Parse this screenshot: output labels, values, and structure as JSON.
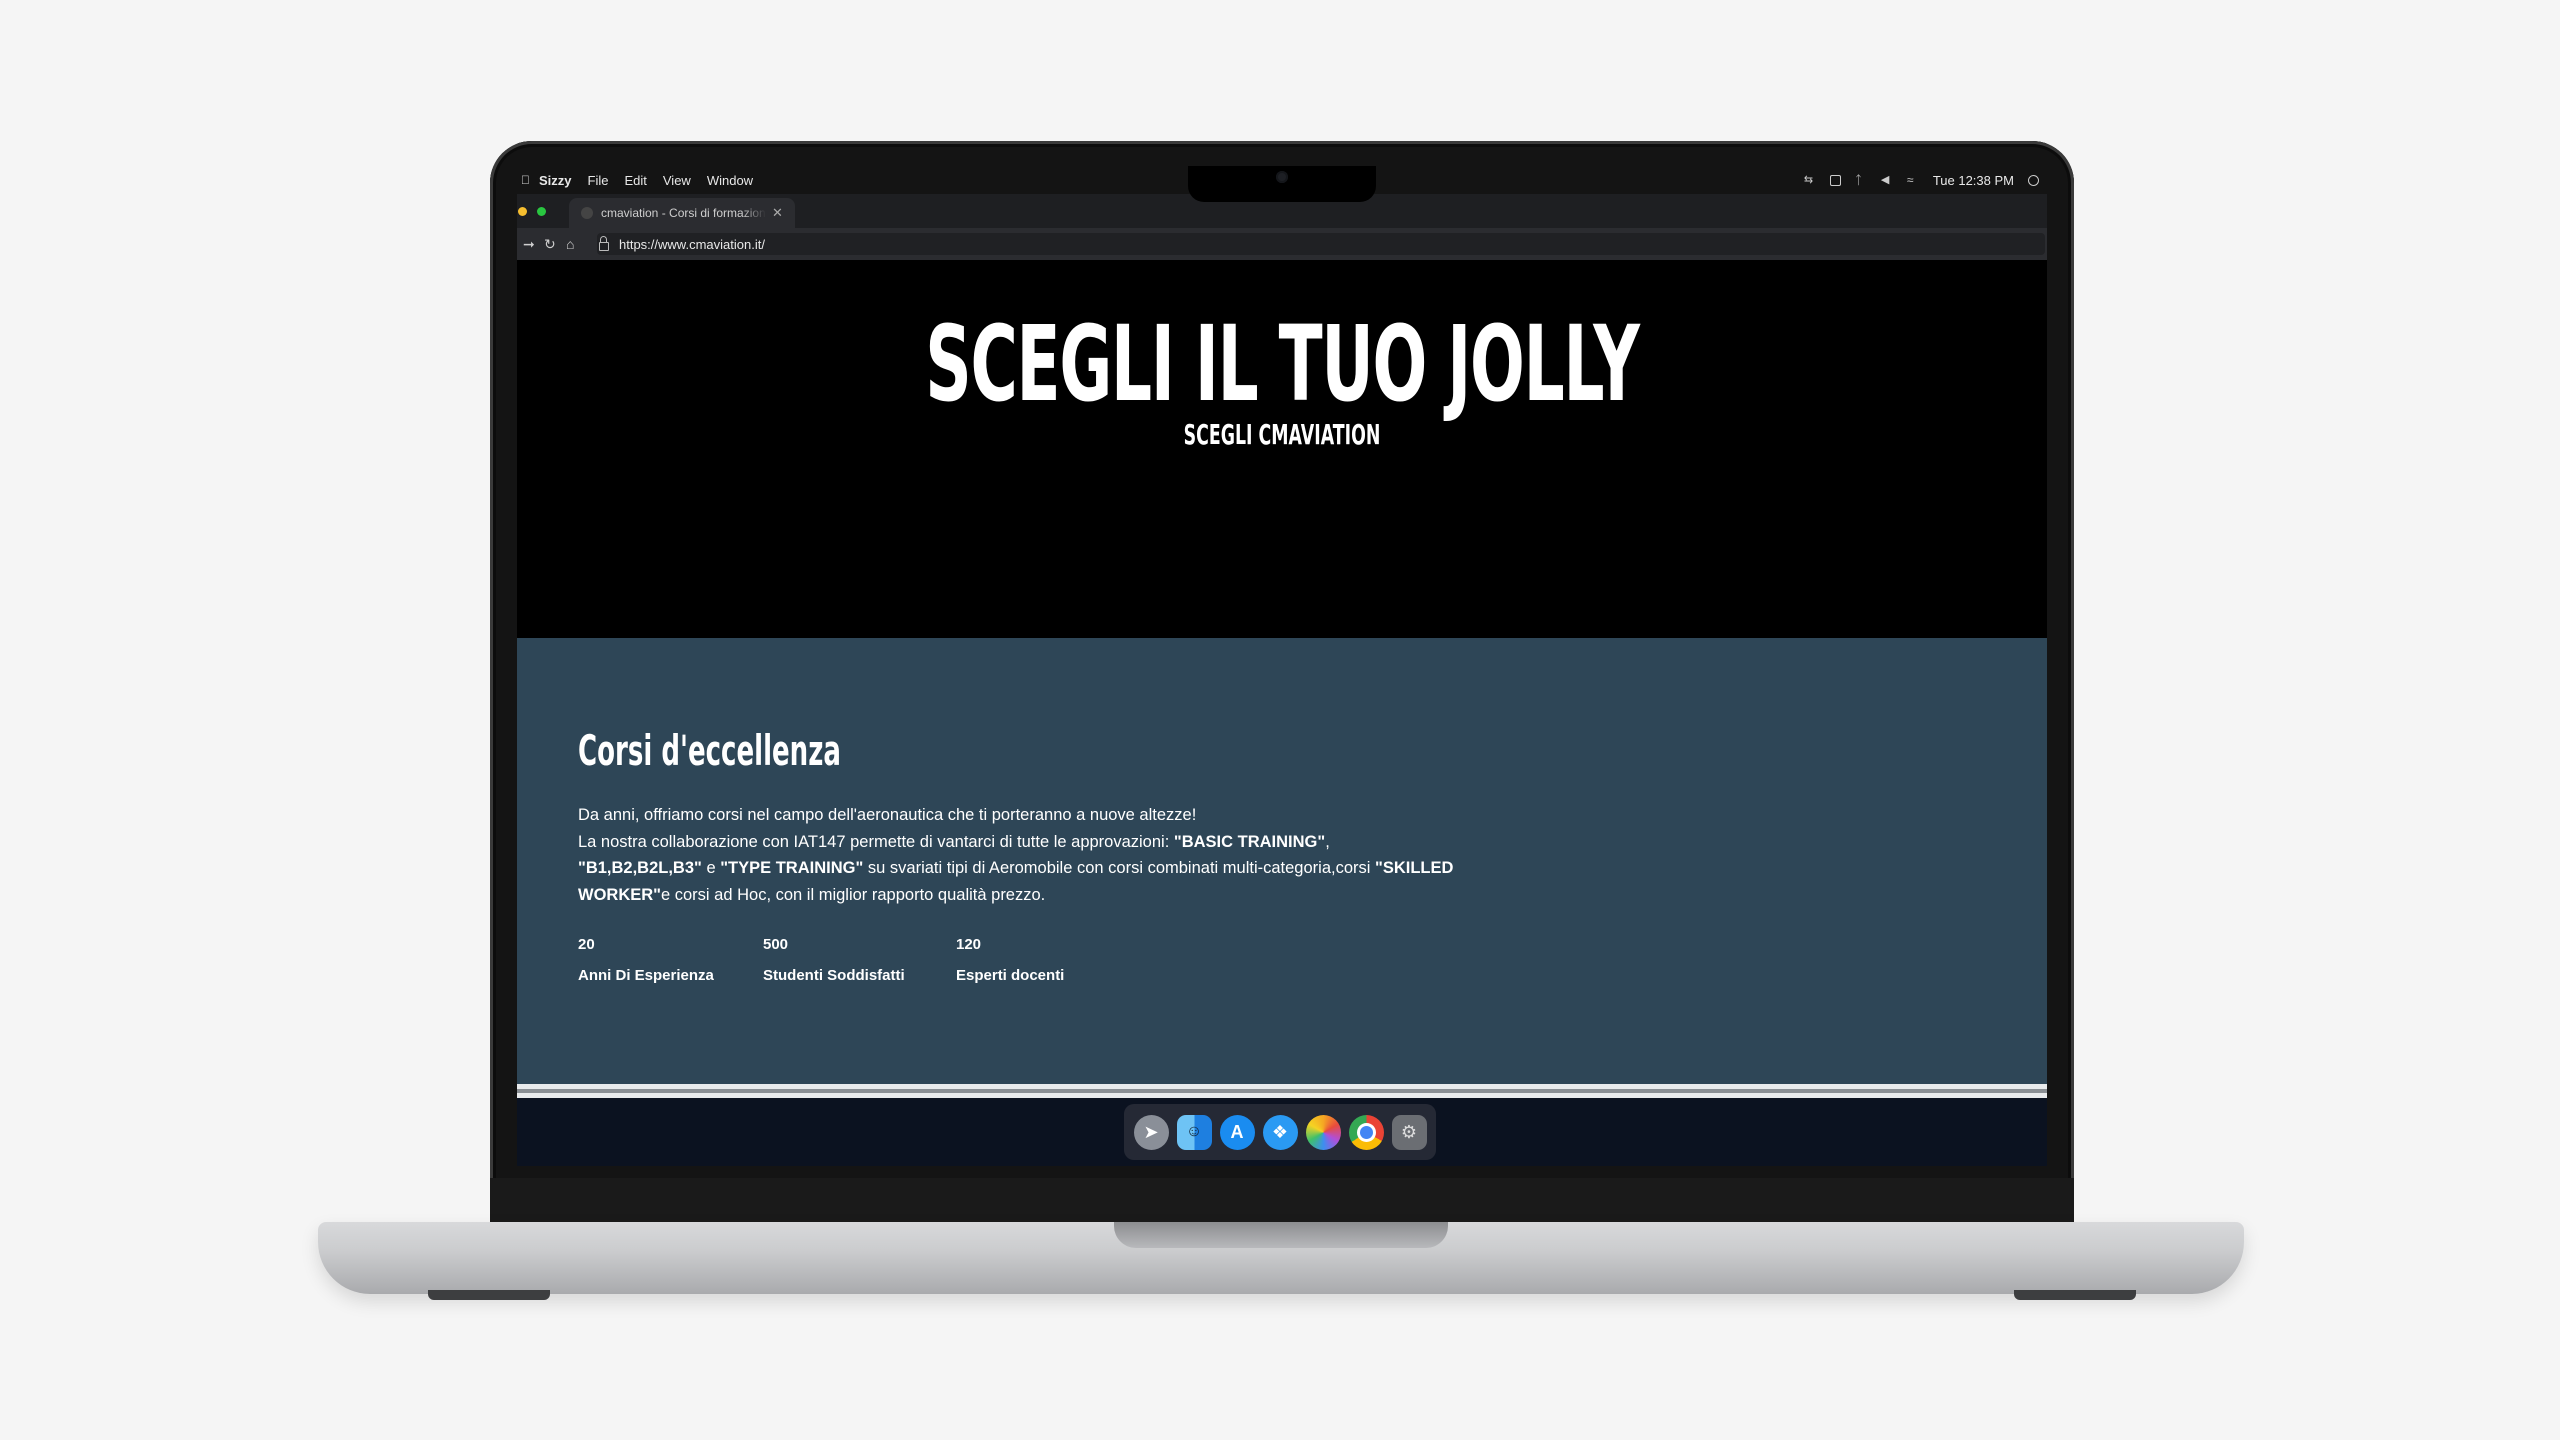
{
  "menubar": {
    "app_name": "Sizzy",
    "menus": [
      "File",
      "Edit",
      "View",
      "Window"
    ],
    "clock": "Tue 12:38 PM"
  },
  "browser": {
    "tab_title": "cmaviation - Corsi di formazione",
    "url": "https://www.cmaviation.it/"
  },
  "hero": {
    "title": "SCEGLI IL TUO JOLLY",
    "subtitle": "SCEGLI CMAVIATION"
  },
  "section": {
    "title": "Corsi d'eccellenza",
    "line1": "Da anni, offriamo corsi nel campo dell'aeronautica che ti porteranno a nuove altezze!",
    "line2_prefix": "La nostra collaborazione con IAT147 permette di vantarci di tutte le approvazioni: ",
    "basic": "\"BASIC TRAINING\"",
    "comma": ",",
    "b1": "\"B1,B2,B2L,B3\"",
    "and": " e ",
    "type": "\"TYPE TRAINING\"",
    "mid": " su svariati tipi di Aeromobile con corsi combinati multi-categoria,corsi ",
    "skilled": "\"SKILLED WORKER\"",
    "end": "e corsi ad Hoc, con il miglior rapporto qualità prezzo."
  },
  "stats": [
    {
      "number": "20",
      "label": "Anni Di Esperienza"
    },
    {
      "number": "500",
      "label": "Studenti Soddisfatti"
    },
    {
      "number": "120",
      "label": "Esperti docenti"
    }
  ],
  "dock": {
    "apps": [
      "launchpad-icon",
      "finder-icon",
      "app-store-icon",
      "safari-icon",
      "photos-icon",
      "chrome-icon",
      "settings-icon"
    ]
  }
}
